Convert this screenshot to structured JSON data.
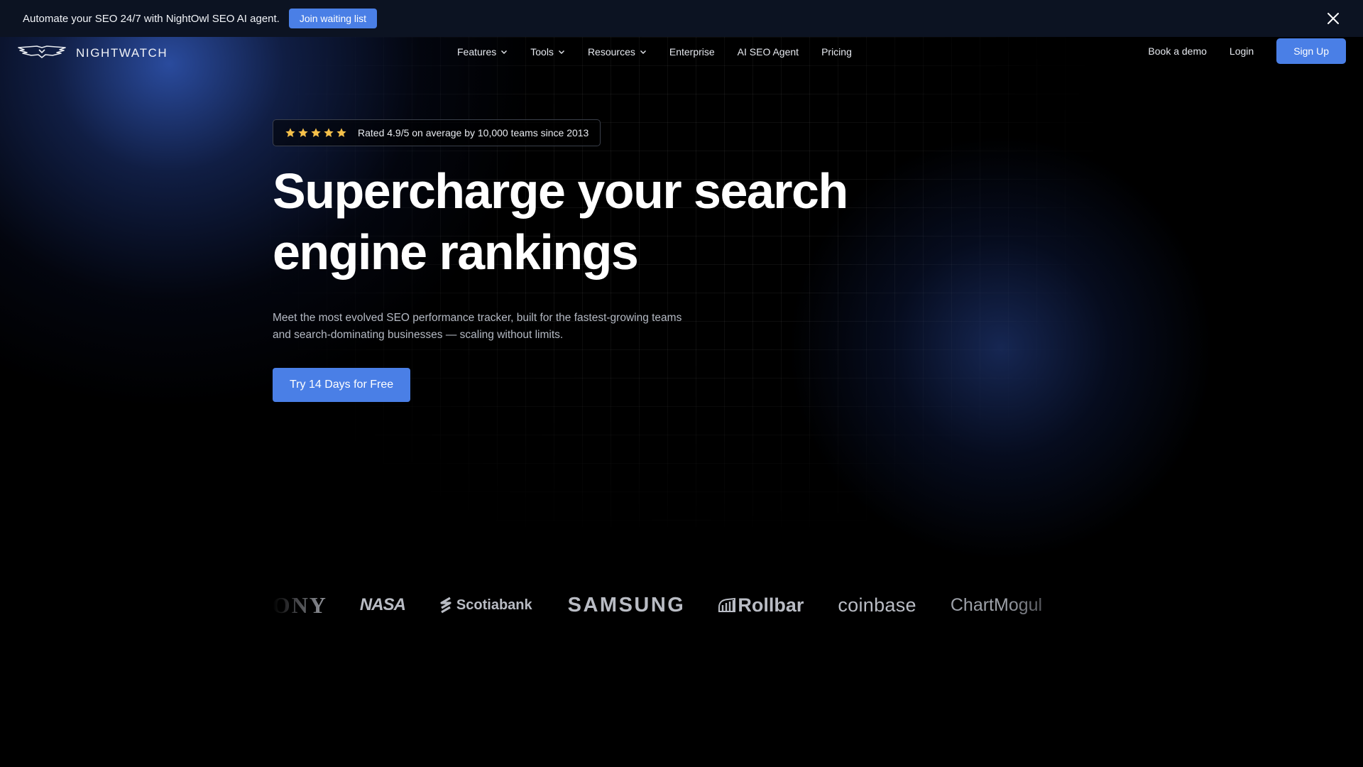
{
  "announcement": {
    "text": "Automate your SEO 24/7 with NightOwl SEO AI agent.",
    "button_label": "Join waiting list"
  },
  "nav": {
    "brand": "NIGHTWATCH",
    "menu": [
      {
        "label": "Features",
        "dropdown": true
      },
      {
        "label": "Tools",
        "dropdown": true
      },
      {
        "label": "Resources",
        "dropdown": true
      },
      {
        "label": "Enterprise",
        "dropdown": false
      },
      {
        "label": "AI SEO Agent",
        "dropdown": false
      },
      {
        "label": "Pricing",
        "dropdown": false
      }
    ],
    "book_demo": "Book a demo",
    "login": "Login",
    "signup": "Sign Up"
  },
  "hero": {
    "rating_stars": 5,
    "rating_text": "Rated 4.9/5 on average by 10,000 teams since 2013",
    "headline_line1": "Supercharge your search",
    "headline_line2": "engine rankings",
    "subtext": "Meet the most evolved SEO performance tracker, built for the fastest-growing teams and search-dominating businesses — scaling without limits.",
    "cta": "Try 14 Days for Free"
  },
  "logos": {
    "sony": "SONY",
    "nasa": "NASA",
    "scotiabank": "Scotiabank",
    "samsung": "SAMSUNG",
    "rollbar": "Rollbar",
    "coinbase": "coinbase",
    "chartmogul": "ChartMogul"
  },
  "colors": {
    "accent": "#4a7fe6",
    "background": "#000000",
    "announcement_bg": "#0c1322",
    "star": "#f5c04a"
  }
}
